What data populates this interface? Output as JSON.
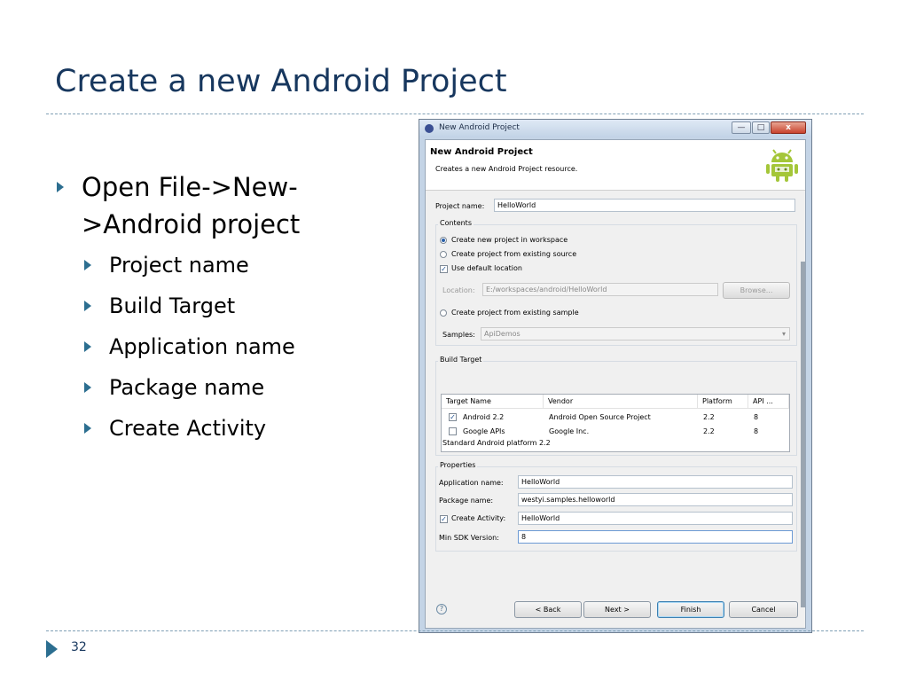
{
  "slide": {
    "title": "Create a new Android Project",
    "bullets": {
      "main_line1": "Open File->New-",
      "main_line2": ">Android project",
      "sub": [
        "Project name",
        "Build Target",
        "Application name",
        "Package name",
        "Create Activity"
      ]
    },
    "page_number": "32",
    "colors": {
      "title": "#17375e",
      "bullet_arrow": "#2c6e90",
      "dash_line": "#7f9fb5"
    }
  },
  "dialog": {
    "window_title": "New Android Project",
    "window_buttons": {
      "minimize": "—",
      "maximize": "□",
      "close": "x"
    },
    "header_title": "New Android Project",
    "header_desc": "Creates a new Android Project resource.",
    "header_icon": "android-robot-icon",
    "project_name_label": "Project name:",
    "project_name_value": "HelloWorld",
    "contents": {
      "label": "Contents",
      "create_new": "Create new project in workspace",
      "create_from_source": "Create project from existing source",
      "use_default_location": "Use default location",
      "location_label": "Location:",
      "location_value": "E:/workspaces/android/HelloWorld",
      "browse_label": "Browse...",
      "create_from_sample": "Create project from existing sample",
      "samples_label": "Samples:",
      "samples_value": "ApiDemos"
    },
    "build_target": {
      "label": "Build Target",
      "columns": [
        "Target Name",
        "Vendor",
        "Platform",
        "API ..."
      ],
      "rows": [
        {
          "checked": true,
          "name": "Android 2.2",
          "vendor": "Android Open Source Project",
          "platform": "2.2",
          "api": "8"
        },
        {
          "checked": false,
          "name": "Google APIs",
          "vendor": "Google Inc.",
          "platform": "2.2",
          "api": "8"
        }
      ],
      "status": "Standard Android platform 2.2"
    },
    "properties": {
      "label": "Properties",
      "application_name_label": "Application name:",
      "application_name_value": "HelloWorld",
      "package_name_label": "Package name:",
      "package_name_value": "westyi.samples.helloworld",
      "create_activity_label": "Create Activity:",
      "create_activity_value": "HelloWorld",
      "min_sdk_label": "Min SDK Version:",
      "min_sdk_value": "8"
    },
    "buttons": {
      "help": "?",
      "back": "< Back",
      "next": "Next >",
      "finish": "Finish",
      "cancel": "Cancel"
    },
    "check_mark": "✓",
    "dropdown_arrow": "▾"
  }
}
